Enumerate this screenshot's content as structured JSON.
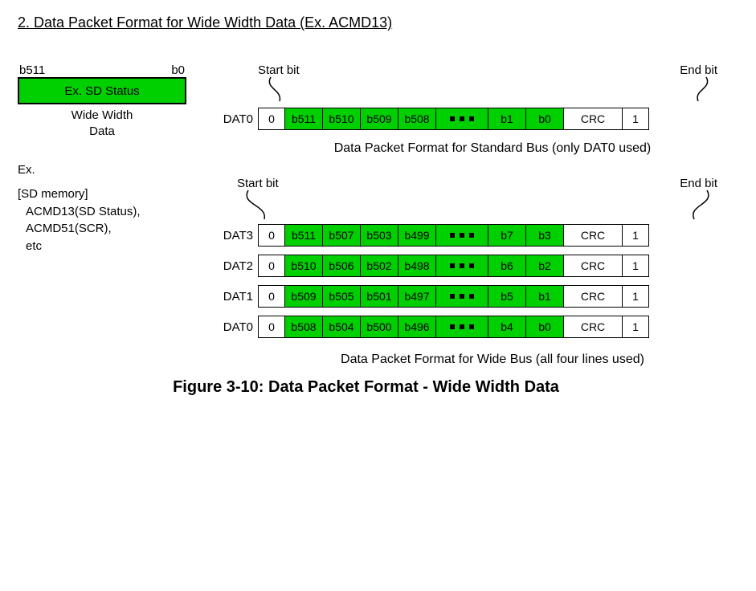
{
  "heading": "2. Data Packet Format for Wide Width Data (Ex. ACMD13)",
  "left": {
    "msb": "b511",
    "lsb": "b0",
    "box": "Ex. SD Status",
    "caption1": "Wide Width",
    "caption2": "Data",
    "ex_label": "Ex.",
    "ex_line1": "[SD memory]",
    "ex_line2": "ACMD13(SD Status),",
    "ex_line3": "ACMD51(SCR),",
    "ex_line4": "etc"
  },
  "labels": {
    "start": "Start bit",
    "end": "End bit",
    "crc": "CRC",
    "zero": "0",
    "one": "1"
  },
  "std": {
    "lane": "DAT0",
    "bits": [
      "b511",
      "b510",
      "b509",
      "b508",
      "b1",
      "b0"
    ],
    "caption": "Data Packet Format for Standard Bus (only DAT0 used)"
  },
  "wide": {
    "lanes": [
      {
        "name": "DAT3",
        "bits": [
          "b511",
          "b507",
          "b503",
          "b499",
          "b7",
          "b3"
        ]
      },
      {
        "name": "DAT2",
        "bits": [
          "b510",
          "b506",
          "b502",
          "b498",
          "b6",
          "b2"
        ]
      },
      {
        "name": "DAT1",
        "bits": [
          "b509",
          "b505",
          "b501",
          "b497",
          "b5",
          "b1"
        ]
      },
      {
        "name": "DAT0",
        "bits": [
          "b508",
          "b504",
          "b500",
          "b496",
          "b4",
          "b0"
        ]
      }
    ],
    "caption": "Data Packet Format for Wide Bus (all four lines used)"
  },
  "figure": "Figure 3-10: Data Packet Format - Wide Width Data"
}
